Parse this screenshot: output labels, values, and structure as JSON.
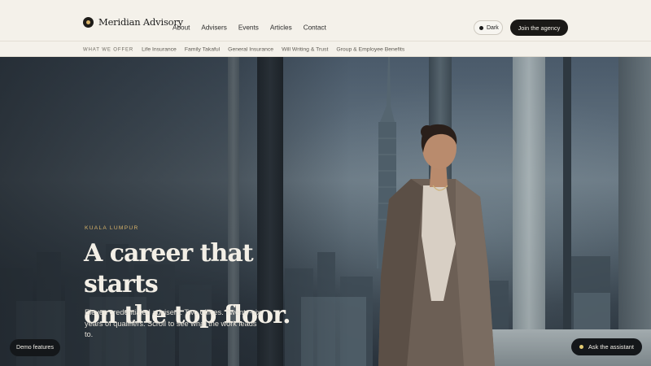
{
  "brand": {
    "name": "Meridian Advisory",
    "accent": "#d8b36a"
  },
  "nav": {
    "items": [
      {
        "label": "About"
      },
      {
        "label": "Advisers"
      },
      {
        "label": "Events"
      },
      {
        "label": "Articles"
      },
      {
        "label": "Contact"
      }
    ],
    "theme_toggle_label": "Dark",
    "cta_label": "Join the agency"
  },
  "subnav": {
    "heading": "WHAT WE OFFER",
    "items": [
      {
        "label": "Life Insurance"
      },
      {
        "label": "Family Takaful"
      },
      {
        "label": "General Insurance"
      },
      {
        "label": "Will Writing & Trust"
      },
      {
        "label": "Group & Employee Benefits"
      }
    ]
  },
  "hero": {
    "eyebrow": "KUALA LUMPUR",
    "headline_line1": "A career that starts",
    "headline_line2": "on the top floor.",
    "lede": "Eleven credentialed advisers. Two offices. Twenty-six years of qualifiers. Scroll to see what the work leads to."
  },
  "floating": {
    "demo_label": "Demo features",
    "assistant_label": "Ask the assistant"
  },
  "colors": {
    "background": "#f4f1ea",
    "dark_button": "#1a1917",
    "assistant_dot": "#e4cc74"
  }
}
